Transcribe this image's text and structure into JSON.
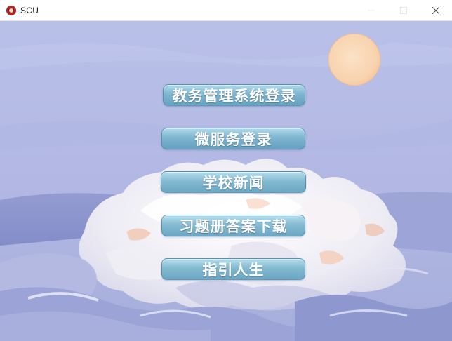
{
  "window": {
    "title": "SCU",
    "app_icon": "university-seal-icon",
    "controls": [
      "minimize-icon",
      "maximize-icon",
      "close-icon"
    ]
  },
  "menu": {
    "buttons": [
      {
        "label": "教务管理系统登录"
      },
      {
        "label": "微服务登录"
      },
      {
        "label": "学校新闻"
      },
      {
        "label": "习题册答案下载"
      },
      {
        "label": "指引人生"
      }
    ]
  },
  "background": {
    "sky_color": "#b6bde6",
    "sun_color": "#f9d7b6",
    "cloud_color": "#f4f2f6"
  }
}
